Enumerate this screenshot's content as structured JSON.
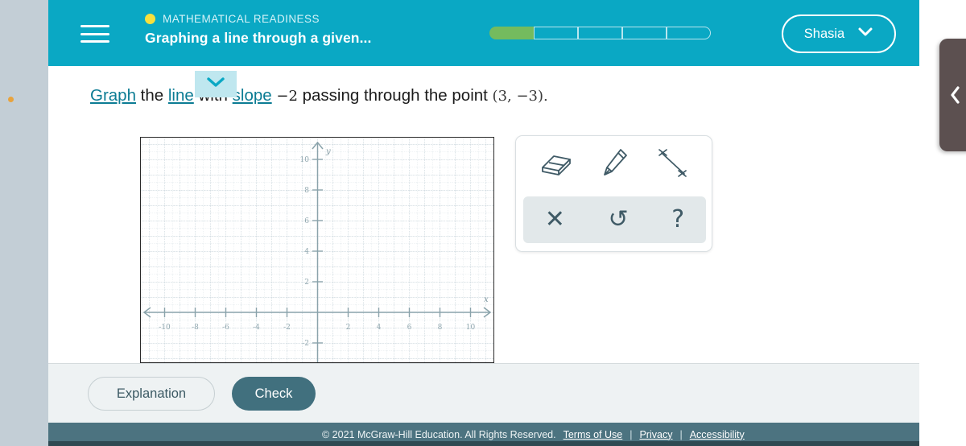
{
  "header": {
    "menu_icon": "hamburger-icon",
    "course_label": "MATHEMATICAL READINESS",
    "topic_label": "Graphing a line through a given...",
    "course_dot_color": "#f7e03d",
    "background_color": "#0aa8c4",
    "user_name": "Shasia",
    "user_chevron_icon": "chevron-down-icon",
    "progress": {
      "total_steps": 5,
      "completed_steps": 1,
      "fill_color": "#74bb5e"
    }
  },
  "question": {
    "link_graph": "Graph",
    "text_the": " the ",
    "link_line": "line",
    "text_with": " with ",
    "link_slope": "slope",
    "slope_value": "−2",
    "text_passing": " passing through the point ",
    "point_value": "(3, −3)",
    "period": "."
  },
  "hint": {
    "icon": "chevron-down-icon",
    "background_color": "#bfe7ef"
  },
  "graph": {
    "x_ticks": [
      "-10",
      "-8",
      "-6",
      "-4",
      "-2",
      "2",
      "4",
      "6",
      "8",
      "10"
    ],
    "y_ticks": [
      "10",
      "8",
      "6",
      "4",
      "2",
      "-2"
    ],
    "x_axis_label": "x",
    "y_axis_label": "y",
    "axis_color": "#8aa3ab",
    "grid_color": "#c9d6dc",
    "border_color": "#2a2a2a"
  },
  "chart_data": {
    "type": "scatter",
    "title": "",
    "xlabel": "x",
    "ylabel": "y",
    "xlim": [
      -11.5,
      11.5
    ],
    "ylim": [
      -3.5,
      11.5
    ],
    "xticks": [
      -10,
      -8,
      -6,
      -4,
      -2,
      2,
      4,
      6,
      8,
      10
    ],
    "yticks": [
      10,
      8,
      6,
      4,
      2,
      -2
    ],
    "grid": true,
    "grid_step": 0.5,
    "series": [],
    "annotations": [],
    "legend": "none"
  },
  "palette": {
    "tools": [
      {
        "name": "eraser-tool",
        "icon": "eraser-icon"
      },
      {
        "name": "pencil-tool",
        "icon": "pencil-icon"
      },
      {
        "name": "line-tool",
        "icon": "line-segment-icon"
      }
    ],
    "actions": [
      {
        "name": "clear-action",
        "icon": "x-icon",
        "glyph": "✕"
      },
      {
        "name": "undo-action",
        "icon": "undo-icon",
        "glyph": "↺"
      },
      {
        "name": "help-action",
        "icon": "question-mark-icon",
        "glyph": "?"
      }
    ]
  },
  "actions": {
    "explanation_label": "Explanation",
    "check_label": "Check",
    "check_color": "#41707e"
  },
  "footer": {
    "copyright": "© 2021 McGraw-Hill Education. All Rights Reserved.",
    "links": [
      "Terms of Use",
      "Privacy",
      "Accessibility"
    ],
    "separator": "|",
    "background_color": "#4c7380"
  },
  "side_panel": {
    "collapse_icon": "chevron-left-icon",
    "background_color": "#5c5050"
  }
}
